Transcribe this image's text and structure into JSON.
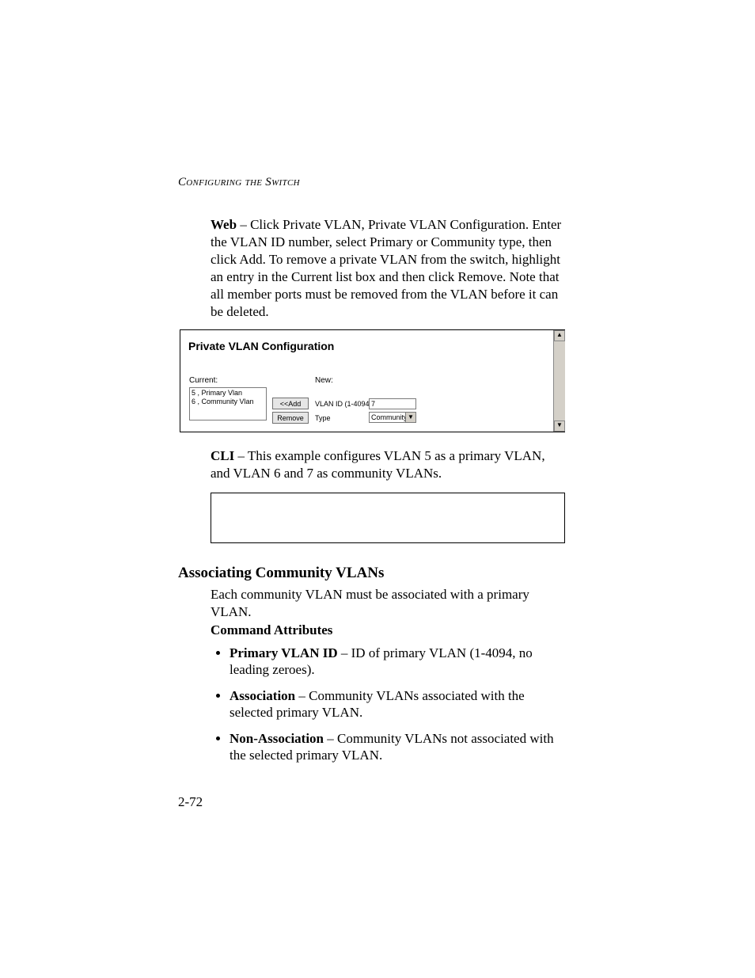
{
  "running_head": "Configuring the Switch",
  "para_web_label": "Web",
  "para_web_body": " – Click Private VLAN, Private VLAN Configuration. Enter the VLAN ID number, select Primary or Community type, then click Add. To remove a private VLAN from the switch, highlight an entry in the Current list box and then click Remove. Note that all member ports must be removed from the VLAN before it can be deleted.",
  "figure": {
    "title": "Private VLAN Configuration",
    "label_current": "Current:",
    "label_new": "New:",
    "list_items": [
      "5 , Primary Vlan",
      "6 , Community Vlan"
    ],
    "btn_add": "<<Add",
    "btn_remove": "Remove",
    "label_vlanid": "VLAN ID (1-4094)",
    "value_vlanid": "7",
    "label_type": "Type",
    "value_type": "Community",
    "scroll_up": "▲",
    "scroll_down": "▼",
    "sel_arrow": "▼"
  },
  "para_cli_label": "CLI",
  "para_cli_body": " – This example configures VLAN 5 as a primary VLAN, and VLAN 6 and 7 as community VLANs.",
  "h2": "Associating Community VLANs",
  "h2_para": "Each community VLAN must be associated with a primary VLAN.",
  "h3": "Command Attributes",
  "bullets": {
    "b1_label": "Primary VLAN ID",
    "b1_body": " – ID of primary VLAN (1-4094, no leading zeroes).",
    "b2_label": "Association",
    "b2_body": " – Community VLANs associated with the selected primary VLAN.",
    "b3_label": "Non-Association",
    "b3_body": " – Community VLANs not associated with the selected primary VLAN."
  },
  "page_number": "2-72"
}
